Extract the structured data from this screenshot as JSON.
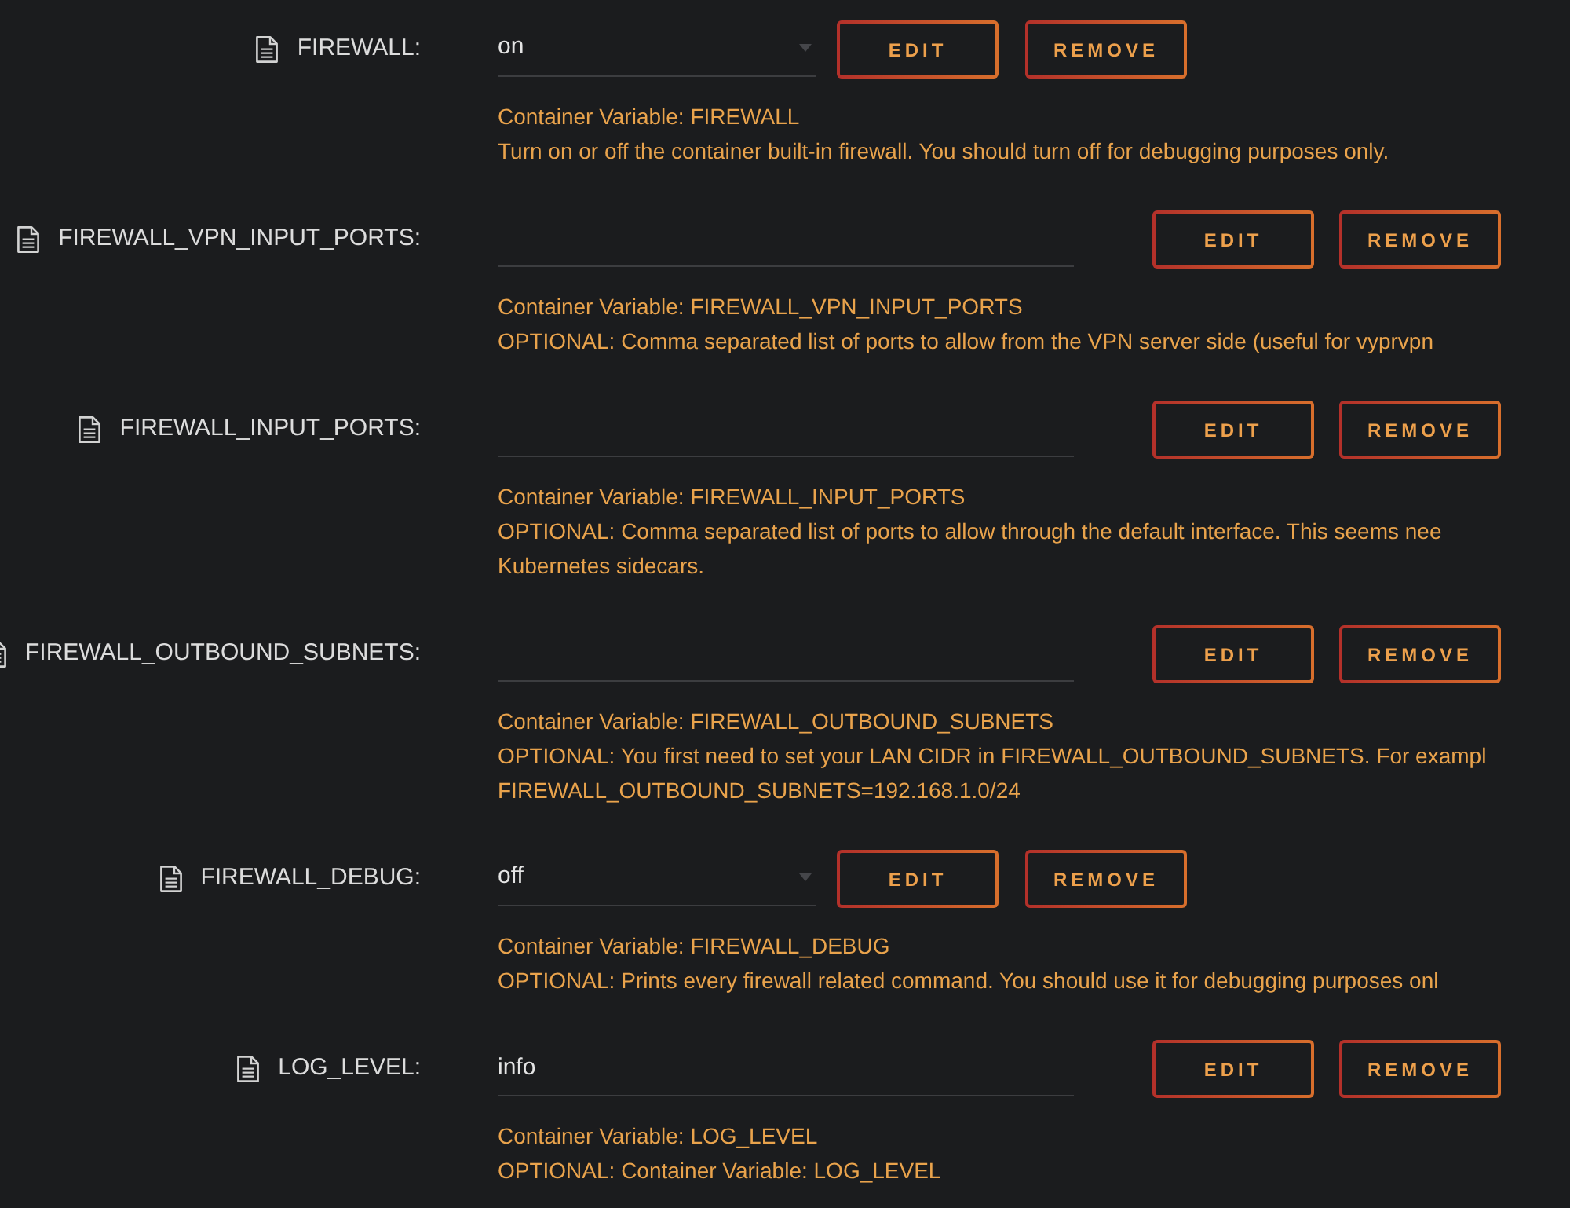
{
  "variables": [
    {
      "label": "FIREWALL:",
      "kind": "select",
      "value": "on",
      "buttons": [
        "EDIT",
        "REMOVE"
      ],
      "help_lines": [
        "Container Variable: FIREWALL",
        "Turn on or off the container built-in firewall. You should turn off for debugging purposes only."
      ]
    },
    {
      "label": "FIREWALL_VPN_INPUT_PORTS:",
      "kind": "text",
      "buttons": [
        "EDIT",
        "REMOVE"
      ],
      "help_lines": [
        "Container Variable: FIREWALL_VPN_INPUT_PORTS",
        "OPTIONAL: Comma separated list of ports to allow from the VPN server side (useful for vyprvpn"
      ]
    },
    {
      "label": "FIREWALL_INPUT_PORTS:",
      "kind": "text",
      "buttons": [
        "EDIT",
        "REMOVE"
      ],
      "help_lines": [
        "Container Variable: FIREWALL_INPUT_PORTS",
        "OPTIONAL: Comma separated list of ports to allow through the default interface. This seems nee",
        "Kubernetes sidecars."
      ]
    },
    {
      "label": "FIREWALL_OUTBOUND_SUBNETS:",
      "kind": "text",
      "buttons": [
        "EDIT",
        "REMOVE"
      ],
      "help_lines": [
        "Container Variable: FIREWALL_OUTBOUND_SUBNETS",
        "OPTIONAL: You first need to set your LAN CIDR in FIREWALL_OUTBOUND_SUBNETS. For exampl",
        "FIREWALL_OUTBOUND_SUBNETS=192.168.1.0/24"
      ]
    },
    {
      "label": "FIREWALL_DEBUG:",
      "kind": "select",
      "value": "off",
      "buttons": [
        "EDIT",
        "REMOVE"
      ],
      "help_lines": [
        "Container Variable: FIREWALL_DEBUG",
        "OPTIONAL: Prints every firewall related command. You should use it for debugging purposes onl"
      ]
    },
    {
      "label": "LOG_LEVEL:",
      "kind": "text",
      "value": "info",
      "buttons": [
        "EDIT",
        "REMOVE"
      ],
      "help_lines": [
        "Container Variable: LOG_LEVEL",
        "OPTIONAL: Container Variable: LOG_LEVEL"
      ]
    }
  ]
}
